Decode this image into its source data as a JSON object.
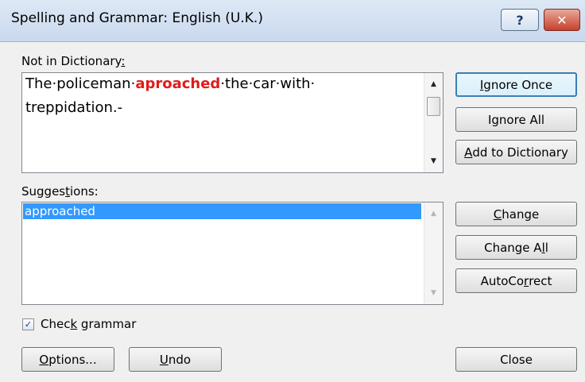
{
  "window": {
    "title": "Spelling and Grammar: English (U.K.)",
    "help_glyph": "?",
    "close_glyph": "✕"
  },
  "not_in_dictionary": {
    "label_pre": "Not in Dictionary",
    "label_u": ":",
    "line1_a": "The·policeman·",
    "line1_error": "aproached",
    "line1_b": "·the·car·with·",
    "line2": "treppidation.-"
  },
  "suggestions": {
    "label_pre": "Sugges",
    "label_u": "t",
    "label_post": "ions:",
    "items": [
      "approached"
    ]
  },
  "buttons": {
    "ignore_once": {
      "u": "I",
      "rest": "gnore Once"
    },
    "ignore_all": {
      "pre": "I",
      "u": "g",
      "rest": "nore All"
    },
    "add_to_dictionary": {
      "u": "A",
      "rest": "dd to Dictionary"
    },
    "change": {
      "u": "C",
      "rest": "hange"
    },
    "change_all": {
      "pre": "Change A",
      "u": "l",
      "rest": "l"
    },
    "autocorrect": {
      "pre": "AutoCo",
      "u": "r",
      "rest": "rect"
    },
    "options": {
      "u": "O",
      "rest": "ptions..."
    },
    "undo": {
      "u": "U",
      "rest": "ndo"
    },
    "close": "Close"
  },
  "check_grammar": {
    "pre": "Chec",
    "u": "k",
    "rest": " grammar",
    "checked": true,
    "mark": "✓"
  },
  "icons": {
    "up_arrow": "▲",
    "down_arrow": "▼"
  }
}
